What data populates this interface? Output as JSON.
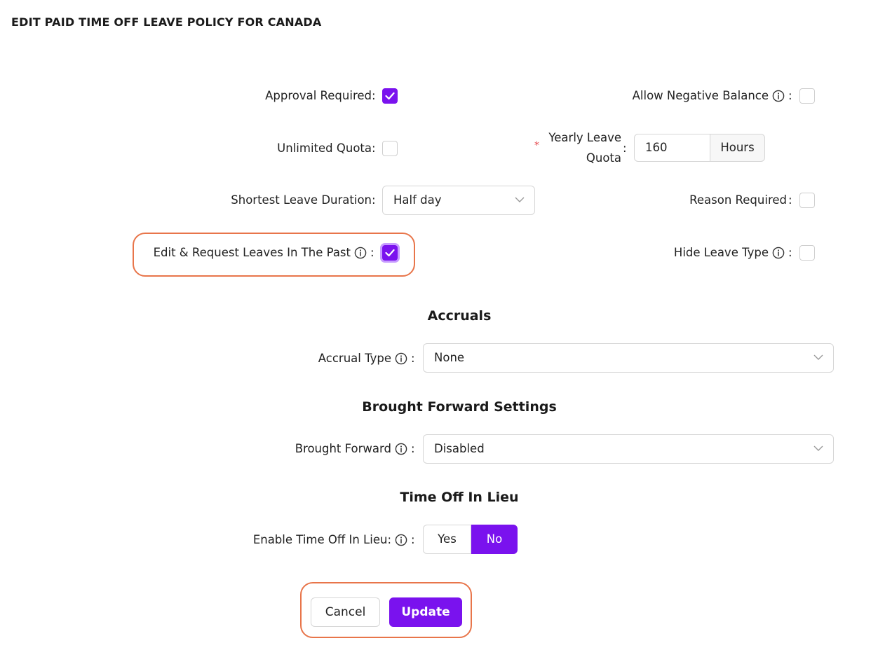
{
  "page": {
    "title": "EDIT PAID TIME OFF LEAVE POLICY FOR CANADA"
  },
  "colon": ":",
  "colors": {
    "accent": "#7a12ee",
    "highlight": "#e8754a",
    "required": "#e5484d"
  },
  "policy": {
    "approval_required": {
      "label": "Approval Required",
      "checked": true
    },
    "allow_negative_balance": {
      "label": "Allow Negative Balance",
      "checked": false,
      "icon": "info-icon"
    },
    "unlimited_quota": {
      "label": "Unlimited Quota",
      "checked": false
    },
    "yearly_leave_quota": {
      "label_line1": "Yearly Leave",
      "label_line2": "Quota",
      "required_mark": "*",
      "value": "160",
      "unit": "Hours"
    },
    "shortest_leave_duration": {
      "label": "Shortest Leave Duration",
      "selected": "Half day"
    },
    "reason_required": {
      "label": "Reason Required",
      "checked": false
    },
    "edit_request_past": {
      "label": "Edit & Request Leaves In The Past",
      "checked": true,
      "icon": "info-icon"
    },
    "hide_leave_type": {
      "label": "Hide Leave Type",
      "checked": false,
      "icon": "info-icon"
    }
  },
  "accruals": {
    "title": "Accruals",
    "accrual_type": {
      "label": "Accrual Type",
      "selected": "None",
      "icon": "info-icon"
    }
  },
  "brought_forward": {
    "title": "Brought Forward Settings",
    "field": {
      "label": "Brought Forward",
      "selected": "Disabled",
      "icon": "info-icon"
    }
  },
  "toil": {
    "title": "Time Off In Lieu",
    "enable": {
      "label": "Enable Time Off In Lieu:",
      "options": [
        "Yes",
        "No"
      ],
      "selected": "No",
      "icon": "info-icon"
    }
  },
  "actions": {
    "cancel": "Cancel",
    "update": "Update"
  }
}
